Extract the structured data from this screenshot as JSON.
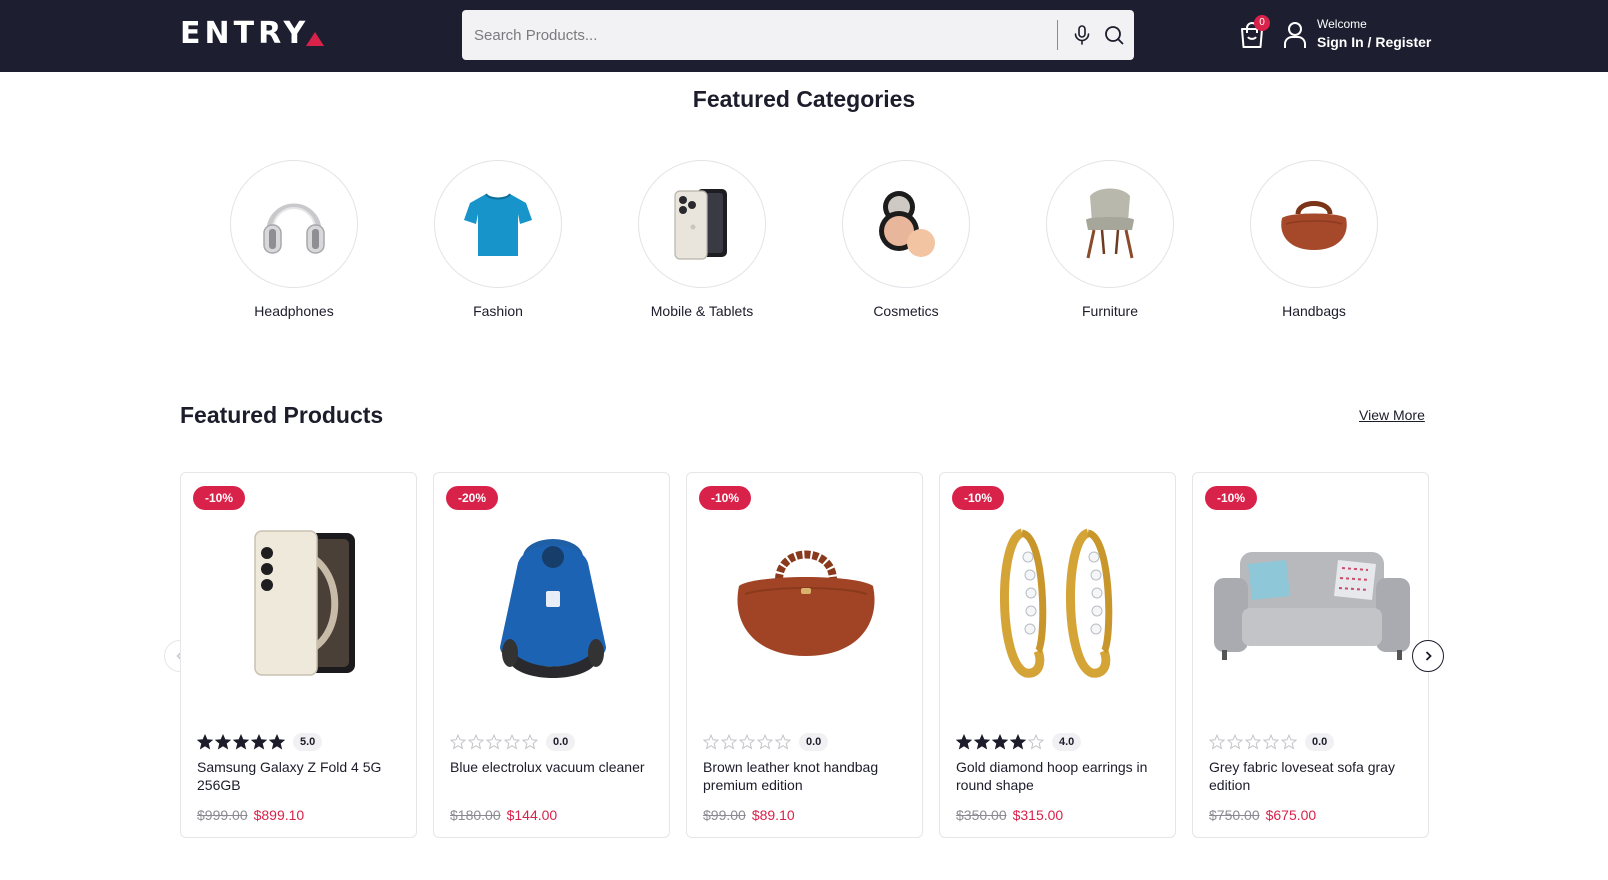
{
  "header": {
    "logo_text": "ENTRY",
    "search_placeholder": "Search Products...",
    "cart_count": "0",
    "welcome": "Welcome",
    "sign_in": "Sign In",
    "separator": " / ",
    "register": "Register"
  },
  "colors": {
    "header_bg": "#1d1e2f",
    "accent": "#d9224a"
  },
  "categories": {
    "title": "Featured Categories",
    "items": [
      {
        "label": "Headphones",
        "icon": "headphones-icon"
      },
      {
        "label": "Fashion",
        "icon": "tshirt-icon"
      },
      {
        "label": "Mobile & Tablets",
        "icon": "smartphone-icon"
      },
      {
        "label": "Cosmetics",
        "icon": "compact-powder-icon"
      },
      {
        "label": "Furniture",
        "icon": "chair-icon"
      },
      {
        "label": "Handbags",
        "icon": "handbag-icon"
      }
    ]
  },
  "products": {
    "title": "Featured Products",
    "view_more": "View More",
    "items": [
      {
        "discount": "-10%",
        "rating": 5,
        "rating_label": "5.0",
        "name": "Samsung Galaxy Z Fold 4 5G 256GB",
        "old_price": "$999.00",
        "price": "$899.10",
        "image": "foldable-phone-image"
      },
      {
        "discount": "-20%",
        "rating": 0,
        "rating_label": "0.0",
        "name": "Blue electrolux vacuum cleaner",
        "old_price": "$180.00",
        "price": "$144.00",
        "image": "vacuum-cleaner-image"
      },
      {
        "discount": "-10%",
        "rating": 0,
        "rating_label": "0.0",
        "name": "Brown leather knot handbag premium edition",
        "old_price": "$99.00",
        "price": "$89.10",
        "image": "handbag-image"
      },
      {
        "discount": "-10%",
        "rating": 4,
        "rating_label": "4.0",
        "name": "Gold diamond hoop earrings in round shape",
        "old_price": "$350.00",
        "price": "$315.00",
        "image": "earrings-image"
      },
      {
        "discount": "-10%",
        "rating": 0,
        "rating_label": "0.0",
        "name": "Grey fabric loveseat sofa gray edition",
        "old_price": "$750.00",
        "price": "$675.00",
        "image": "sofa-image"
      }
    ]
  }
}
